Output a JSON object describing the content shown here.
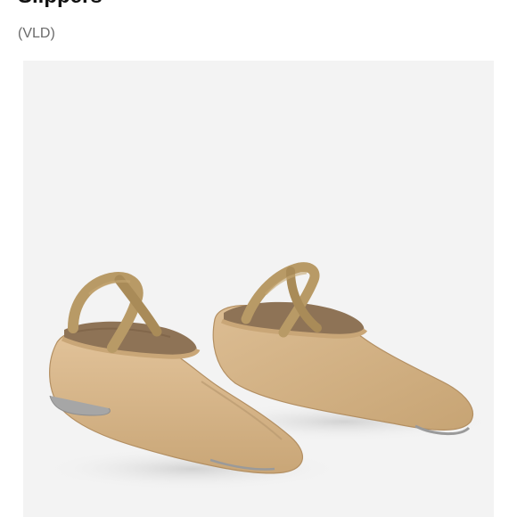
{
  "product": {
    "title": "Slippers",
    "brand": "(VLD)"
  },
  "colors": {
    "panel_background": "#f3f3f3",
    "shoe_canvas": "#d9b98e",
    "shoe_shadow": "#b99a70",
    "shoe_interior": "#8e7356",
    "elastic": "#b89a66",
    "sole": "#b0b0b0"
  },
  "image": {
    "subject": "ballet-slippers-photo"
  }
}
